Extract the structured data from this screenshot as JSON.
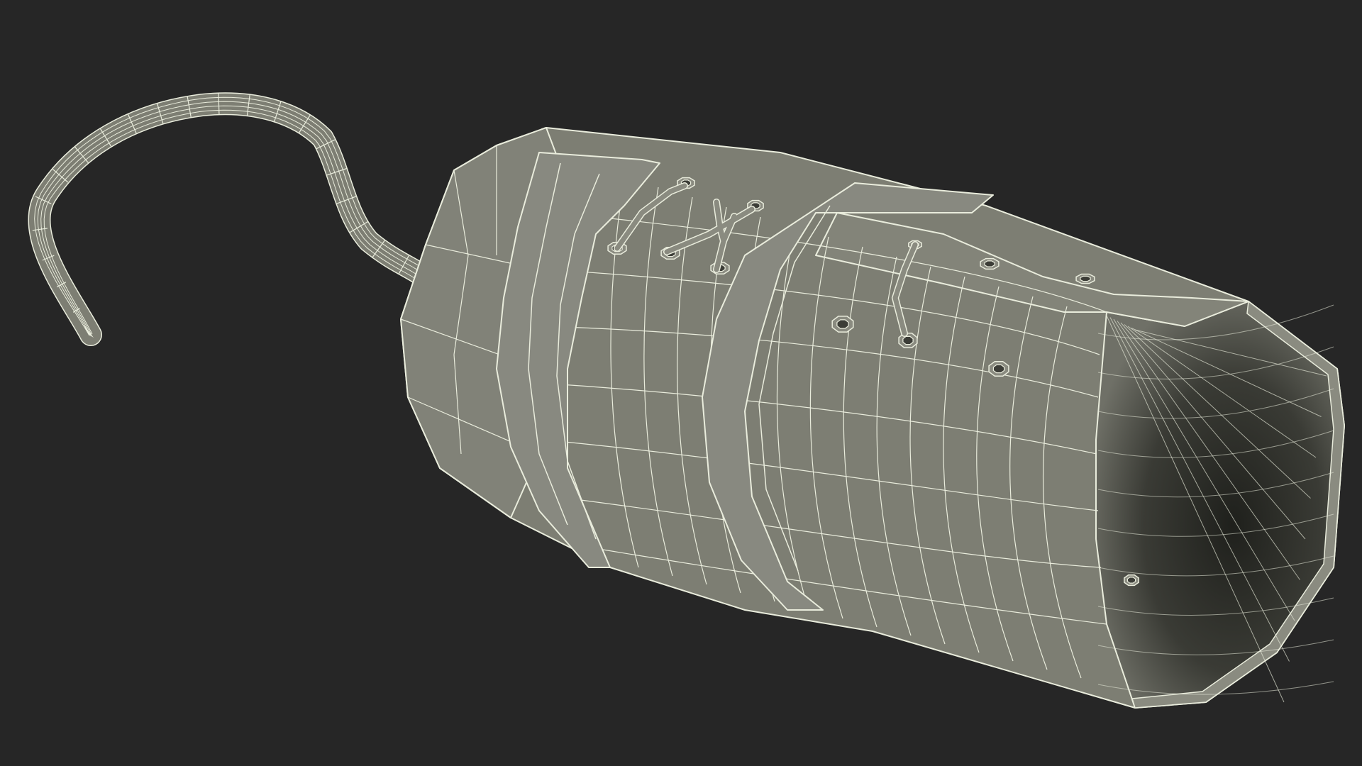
{
  "scene": {
    "subject": "hook-prosthesis-wireframe",
    "colors": {
      "background": "#262626",
      "surface": "#7d7e73",
      "surface_shade": "#6a6b61",
      "interior": "#2f302b",
      "interior_mid": "#4a4b43",
      "wire": "#e9ecdc"
    }
  }
}
